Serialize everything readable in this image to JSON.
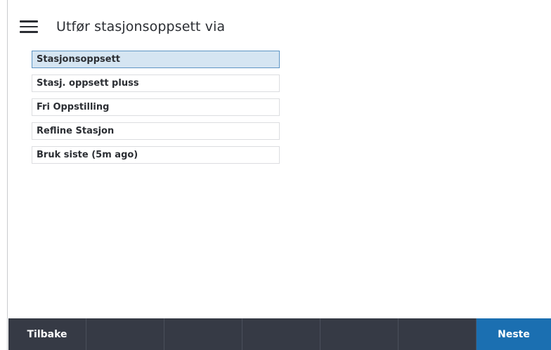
{
  "header": {
    "title": "Utfør stasjonsoppsett via"
  },
  "icons": {
    "menu": "hamburger-menu-icon"
  },
  "options": {
    "selected_index": 0,
    "items": [
      {
        "label": "Stasjonsoppsett"
      },
      {
        "label": "Stasj. oppsett pluss"
      },
      {
        "label": "Fri Oppstilling"
      },
      {
        "label": "Refline Stasjon"
      },
      {
        "label": "Bruk siste (5m ago)"
      }
    ]
  },
  "footer": {
    "back_label": "Tilbake",
    "next_label": "Neste"
  },
  "colors": {
    "bar_background": "#363a45",
    "primary_button": "#1b6fb1",
    "selected_item_fill": "#d5e5f2",
    "selected_item_border": "#5d95c4"
  }
}
